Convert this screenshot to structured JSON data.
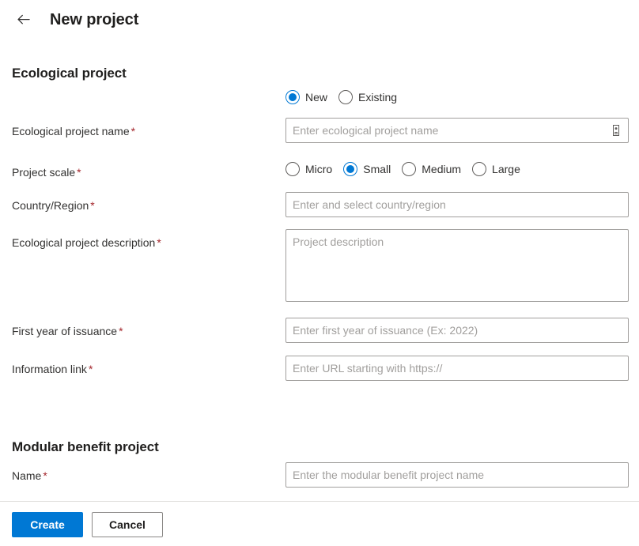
{
  "header": {
    "back_icon": "arrow-left-icon",
    "title": "New project"
  },
  "sections": [
    {
      "id": "ecological-project",
      "heading": "Ecological project"
    },
    {
      "id": "modular-benefit-project",
      "heading": "Modular benefit project"
    }
  ],
  "ecological": {
    "mode_group": {
      "options": [
        {
          "label": "New",
          "selected": true
        },
        {
          "label": "Existing",
          "selected": false
        }
      ]
    },
    "project_name": {
      "label": "Ecological project name",
      "required_marker": "*",
      "placeholder": "Enter ecological project name",
      "value": "",
      "picker_icon": "contact-card-picker-icon"
    },
    "project_scale": {
      "label": "Project scale",
      "required_marker": "*",
      "options": [
        {
          "label": "Micro",
          "selected": false
        },
        {
          "label": "Small",
          "selected": true
        },
        {
          "label": "Medium",
          "selected": false
        },
        {
          "label": "Large",
          "selected": false
        }
      ]
    },
    "country_region": {
      "label": "Country/Region",
      "required_marker": "*",
      "placeholder": "Enter and select country/region",
      "value": ""
    },
    "description": {
      "label": "Ecological project description",
      "required_marker": "*",
      "placeholder": "Project description",
      "value": ""
    },
    "first_year": {
      "label": "First year of issuance",
      "required_marker": "*",
      "placeholder": "Enter first year of issuance (Ex: 2022)",
      "value": ""
    },
    "information_link": {
      "label": "Information link",
      "required_marker": "*",
      "placeholder": "Enter URL starting with https://",
      "value": ""
    }
  },
  "modular": {
    "name": {
      "label": "Name",
      "required_marker": "*",
      "placeholder": "Enter the modular benefit project name",
      "value": ""
    }
  },
  "footer": {
    "create_label": "Create",
    "cancel_label": "Cancel"
  },
  "colors": {
    "accent": "#0078d4",
    "required_asterisk": "#a4262c",
    "input_border": "#a19f9d",
    "text": "#323130",
    "placeholder": "#a19f9d",
    "divider": "#e1dfdd"
  }
}
